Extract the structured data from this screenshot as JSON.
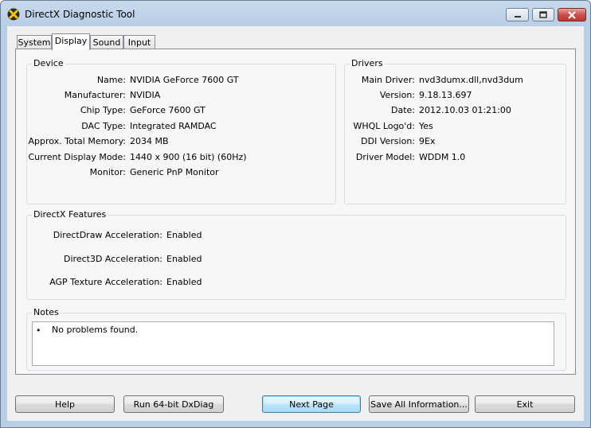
{
  "window": {
    "title": "DirectX Diagnostic Tool"
  },
  "tabs": [
    {
      "label": "System",
      "active": false
    },
    {
      "label": "Display",
      "active": true
    },
    {
      "label": "Sound",
      "active": false
    },
    {
      "label": "Input",
      "active": false
    }
  ],
  "device": {
    "group_label": "Device",
    "rows": [
      {
        "label": "Name:",
        "value": "NVIDIA GeForce 7600 GT"
      },
      {
        "label": "Manufacturer:",
        "value": "NVIDIA"
      },
      {
        "label": "Chip Type:",
        "value": "GeForce 7600 GT"
      },
      {
        "label": "DAC Type:",
        "value": "Integrated RAMDAC"
      },
      {
        "label": "Approx. Total Memory:",
        "value": "2034 MB"
      },
      {
        "label": "Current Display Mode:",
        "value": "1440 x 900 (16 bit) (60Hz)"
      },
      {
        "label": "Monitor:",
        "value": "Generic PnP Monitor"
      }
    ]
  },
  "drivers": {
    "group_label": "Drivers",
    "rows": [
      {
        "label": "Main Driver:",
        "value": "nvd3dumx.dll,nvd3dum"
      },
      {
        "label": "Version:",
        "value": "9.18.13.697"
      },
      {
        "label": "Date:",
        "value": "2012.10.03 01:21:00"
      },
      {
        "label": "WHQL Logo'd:",
        "value": "Yes"
      },
      {
        "label": "DDI Version:",
        "value": "9Ex"
      },
      {
        "label": "Driver Model:",
        "value": "WDDM 1.0"
      }
    ]
  },
  "features": {
    "group_label": "DirectX Features",
    "rows": [
      {
        "label": "DirectDraw Acceleration:",
        "value": "Enabled"
      },
      {
        "label": "Direct3D Acceleration:",
        "value": "Enabled"
      },
      {
        "label": "AGP Texture Acceleration:",
        "value": "Enabled"
      }
    ]
  },
  "notes": {
    "group_label": "Notes",
    "items": [
      "No problems found."
    ]
  },
  "buttons": {
    "help": "Help",
    "run64": "Run 64-bit DxDiag",
    "next_page": "Next Page",
    "save_all": "Save All Information...",
    "exit": "Exit"
  }
}
